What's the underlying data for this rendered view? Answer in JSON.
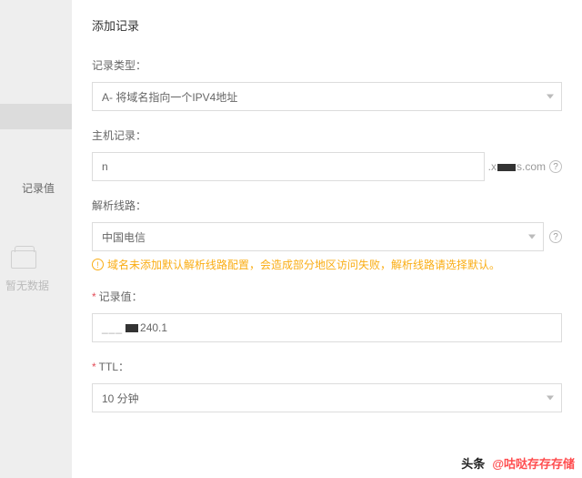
{
  "backdrop": {
    "labelRecordValue": "记录值",
    "noData": "暂无数据"
  },
  "panel": {
    "title": "添加记录",
    "recordType": {
      "label": "记录类型：",
      "value": "A- 将域名指向一个IPV4地址"
    },
    "hostRecord": {
      "label": "主机记录：",
      "value": "n",
      "suffixPre": ".x",
      "suffixPost": "s.com"
    },
    "line": {
      "label": "解析线路：",
      "value": "中国电信",
      "warning": "域名未添加默认解析线路配置，会造成部分地区访问失败，解析线路请选择默认。"
    },
    "recordValue": {
      "label": "记录值：",
      "valuePre": "___",
      "valuePost": "240.1"
    },
    "ttl": {
      "label": "TTL：",
      "value": "10 分钟"
    }
  },
  "watermark": {
    "label": "头条",
    "text": "@咕哒存存存储"
  }
}
